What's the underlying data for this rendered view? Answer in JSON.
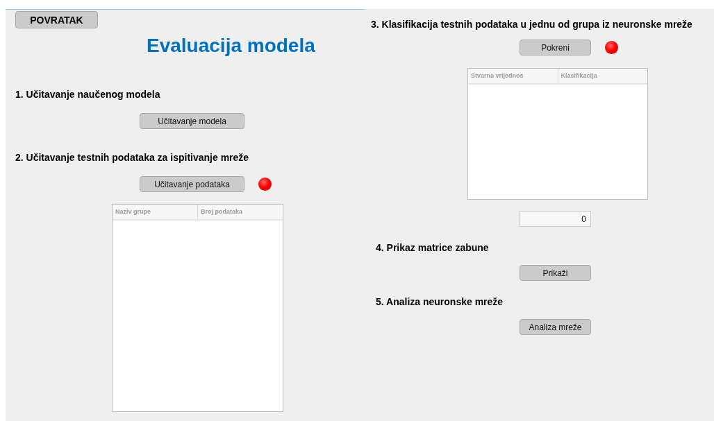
{
  "back_button": "POVRATAK",
  "title": "Evaluacija modela",
  "left_sections": [
    {
      "heading": "1. Učitavanje naučenog modela",
      "button": "Učitavanje modela"
    },
    {
      "heading": "2. Učitavanje testnih podataka za ispitivanje mreže",
      "button": "Učitavanje podataka",
      "indicator": {
        "on": false
      },
      "table": {
        "columns": [
          "Naziv grupe",
          "Broj podataka"
        ]
      }
    }
  ],
  "classification": {
    "heading": "3. Klasifikacija testnih podataka u jednu od grupa iz neuronske mreže",
    "button": "Pokreni",
    "indicator": {
      "on": false
    },
    "table": {
      "columns": [
        "Stvarna vrijednos",
        "Klasifikacija"
      ]
    },
    "count_field": {
      "value": "0"
    }
  },
  "right_sections": [
    {
      "heading": "4. Prikaz matrice zabune",
      "button": "Prikaži"
    },
    {
      "heading": "5. Analiza neuronske mreže",
      "button": "Analiza mreže"
    }
  ]
}
